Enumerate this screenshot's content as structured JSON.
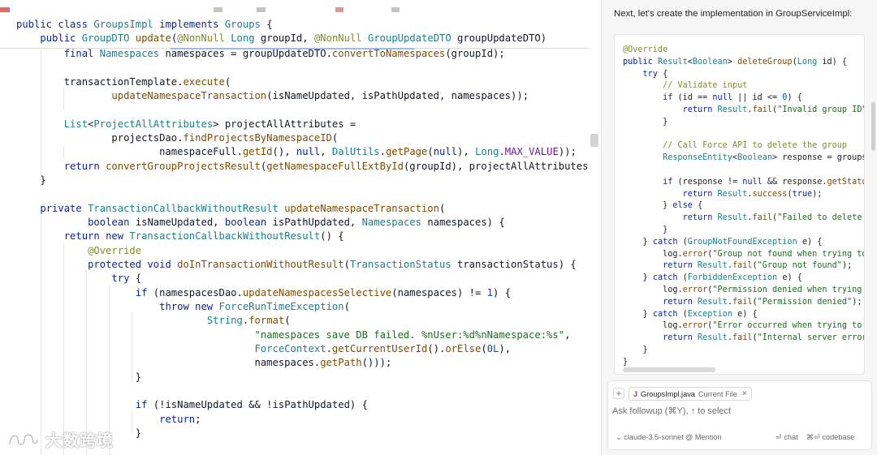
{
  "editor": {
    "sticky": [
      [
        [
          "kw",
          "public class "
        ],
        [
          "ty",
          "GroupsImpl "
        ],
        [
          "kw",
          "implements "
        ],
        [
          "ty",
          "Groups "
        ],
        [
          "",
          "{"
        ]
      ],
      [
        [
          "",
          "    "
        ],
        [
          "kw",
          "public "
        ],
        [
          "ty",
          "GroupDTO "
        ],
        [
          "fn",
          "update"
        ],
        [
          "",
          "("
        ],
        [
          "an",
          "@NonNull "
        ],
        [
          "ty",
          "Long "
        ],
        [
          "",
          "groupId, "
        ],
        [
          "an",
          "@NonNull "
        ],
        [
          "ty",
          "GroupUpdateDTO "
        ],
        [
          "",
          "groupUpdateDTO)"
        ]
      ]
    ],
    "lines": [
      [
        [
          "",
          "        "
        ],
        [
          "kw",
          "final "
        ],
        [
          "ty",
          "Namespaces "
        ],
        [
          "",
          "namespaces = groupUpdateDTO."
        ],
        [
          "fn",
          "convertToNamespaces"
        ],
        [
          "",
          "(groupId);"
        ]
      ],
      [],
      [
        [
          "",
          "        transactionTemplate."
        ],
        [
          "fn",
          "execute"
        ],
        [
          "",
          "("
        ]
      ],
      [
        [
          "",
          "                "
        ],
        [
          "fn",
          "updateNamespaceTransaction"
        ],
        [
          "",
          "(isNameUpdated, isPathUpdated, namespaces));"
        ]
      ],
      [],
      [
        [
          "",
          "        "
        ],
        [
          "ty",
          "List"
        ],
        [
          "",
          "<"
        ],
        [
          "ty",
          "ProjectAllAttributes"
        ],
        [
          "",
          "> projectAllAttributes ="
        ]
      ],
      [
        [
          "",
          "                projectsDao."
        ],
        [
          "fn",
          "findProjectsByNamespaceID"
        ],
        [
          "",
          "("
        ]
      ],
      [
        [
          "",
          "                        namespaceFull."
        ],
        [
          "fn",
          "getId"
        ],
        [
          "",
          "(), "
        ],
        [
          "kw",
          "null"
        ],
        [
          "",
          ", "
        ],
        [
          "ty",
          "DalUtils"
        ],
        [
          "",
          "."
        ],
        [
          "fn",
          "getPage"
        ],
        [
          "",
          "("
        ],
        [
          "kw",
          "null"
        ],
        [
          "",
          "), "
        ],
        [
          "ty",
          "Long"
        ],
        [
          "",
          "."
        ],
        [
          "cst",
          "MAX_VALUE"
        ],
        [
          "",
          "));"
        ]
      ],
      [
        [
          "",
          "        "
        ],
        [
          "kw",
          "return "
        ],
        [
          "fn",
          "convertGroupProjectsResult"
        ],
        [
          "",
          "("
        ],
        [
          "fn",
          "getNamespaceFullExtById"
        ],
        [
          "",
          "(groupId), projectAllAttributes);"
        ]
      ],
      [
        [
          "",
          "    }"
        ]
      ],
      [],
      [
        [
          "",
          "    "
        ],
        [
          "kw",
          "private "
        ],
        [
          "ty",
          "TransactionCallbackWithoutResult "
        ],
        [
          "fn",
          "updateNamespaceTransaction"
        ],
        [
          "",
          "("
        ]
      ],
      [
        [
          "",
          "            "
        ],
        [
          "kw",
          "boolean "
        ],
        [
          "",
          "isNameUpdated, "
        ],
        [
          "kw",
          "boolean "
        ],
        [
          "",
          "isPathUpdated, "
        ],
        [
          "ty",
          "Namespaces "
        ],
        [
          "",
          "namespaces) {"
        ]
      ],
      [
        [
          "",
          "        "
        ],
        [
          "kw",
          "return new "
        ],
        [
          "ty",
          "TransactionCallbackWithoutResult"
        ],
        [
          "",
          "() {"
        ]
      ],
      [
        [
          "",
          "            "
        ],
        [
          "an",
          "@Override"
        ]
      ],
      [
        [
          "",
          "            "
        ],
        [
          "kw",
          "protected void "
        ],
        [
          "fn",
          "doInTransactionWithoutResult"
        ],
        [
          "",
          "("
        ],
        [
          "ty",
          "TransactionStatus "
        ],
        [
          "",
          "transactionStatus) {"
        ]
      ],
      [
        [
          "",
          "                "
        ],
        [
          "kw",
          "try "
        ],
        [
          "",
          "{"
        ]
      ],
      [
        [
          "",
          "                    "
        ],
        [
          "kw",
          "if "
        ],
        [
          "",
          "(namespacesDao."
        ],
        [
          "fn",
          "updateNamespacesSelective"
        ],
        [
          "",
          "(namespaces) != "
        ],
        [
          "nm",
          "1"
        ],
        [
          "",
          ") {"
        ]
      ],
      [
        [
          "",
          "                        "
        ],
        [
          "kw",
          "throw new "
        ],
        [
          "ty",
          "ForceRunTimeException"
        ],
        [
          "",
          "("
        ]
      ],
      [
        [
          "",
          "                                "
        ],
        [
          "ty",
          "String"
        ],
        [
          "",
          "."
        ],
        [
          "fn",
          "format"
        ],
        [
          "",
          "("
        ]
      ],
      [
        [
          "",
          "                                        "
        ],
        [
          "st",
          "\"namespaces save DB failed. %nUser:%d%nNamespace:%s\""
        ],
        [
          "",
          ","
        ]
      ],
      [
        [
          "",
          "                                        "
        ],
        [
          "ty",
          "ForceContext"
        ],
        [
          "",
          "."
        ],
        [
          "fn",
          "getCurrentUserId"
        ],
        [
          "",
          "()."
        ],
        [
          "fn",
          "orElse"
        ],
        [
          "",
          "("
        ],
        [
          "nm",
          "0L"
        ],
        [
          "",
          "),"
        ]
      ],
      [
        [
          "",
          "                                        namespaces."
        ],
        [
          "fn",
          "getPath"
        ],
        [
          "",
          "()));"
        ]
      ],
      [
        [
          "",
          "                    }"
        ]
      ],
      [],
      [
        [
          "",
          "                    "
        ],
        [
          "kw",
          "if "
        ],
        [
          "",
          "(!isNameUpdated && !isPathUpdated) {"
        ]
      ],
      [
        [
          "",
          "                        "
        ],
        [
          "kw",
          "return"
        ],
        [
          "",
          ";"
        ]
      ],
      [
        [
          "",
          "                    }"
        ]
      ]
    ]
  },
  "watermark": {
    "text": "大数跨境"
  },
  "chat": {
    "intro": "Next, let's create the implementation in GroupServiceImpl:",
    "code": [
      [
        [
          "an",
          "@Override"
        ]
      ],
      [
        [
          "kw",
          "public "
        ],
        [
          "ty",
          "Result"
        ],
        [
          "",
          "<"
        ],
        [
          "ty",
          "Boolean"
        ],
        [
          "",
          "> "
        ],
        [
          "fn",
          "deleteGroup"
        ],
        [
          "",
          "("
        ],
        [
          "ty",
          "Long "
        ],
        [
          "",
          "id) {"
        ]
      ],
      [
        [
          "",
          "    "
        ],
        [
          "kw",
          "try "
        ],
        [
          "",
          "{"
        ]
      ],
      [
        [
          "",
          "        "
        ],
        [
          "an",
          "// Validate input"
        ]
      ],
      [
        [
          "",
          "        "
        ],
        [
          "kw",
          "if "
        ],
        [
          "",
          "(id == "
        ],
        [
          "kw",
          "null "
        ],
        [
          "",
          "|| id <= "
        ],
        [
          "nm",
          "0"
        ],
        [
          "",
          ") {"
        ]
      ],
      [
        [
          "",
          "            "
        ],
        [
          "kw",
          "return "
        ],
        [
          "ty",
          "Result"
        ],
        [
          "",
          "."
        ],
        [
          "fn",
          "fail"
        ],
        [
          "",
          "("
        ],
        [
          "st",
          "\"Invalid group ID\""
        ],
        [
          "",
          ");"
        ]
      ],
      [
        [
          "",
          "        }"
        ]
      ],
      [],
      [
        [
          "",
          "        "
        ],
        [
          "an",
          "// Call Force API to delete the group"
        ]
      ],
      [
        [
          "",
          "        "
        ],
        [
          "ty",
          "ResponseEntity"
        ],
        [
          "",
          "<"
        ],
        [
          "ty",
          "Boolean"
        ],
        [
          "",
          "> response = groupsApi."
        ],
        [
          "fn",
          "deleteGroup"
        ],
        [
          "",
          "(id);"
        ]
      ],
      [],
      [
        [
          "",
          "        "
        ],
        [
          "kw",
          "if "
        ],
        [
          "",
          "(response != "
        ],
        [
          "kw",
          "null "
        ],
        [
          "",
          "&& response."
        ],
        [
          "fn",
          "getStatusCode"
        ],
        [
          "",
          "()."
        ],
        [
          "fn",
          "is2xxSuccessful"
        ],
        [
          "",
          "()) {"
        ]
      ],
      [
        [
          "",
          "            "
        ],
        [
          "kw",
          "return "
        ],
        [
          "ty",
          "Result"
        ],
        [
          "",
          "."
        ],
        [
          "fn",
          "success"
        ],
        [
          "",
          "("
        ],
        [
          "kw",
          "true"
        ],
        [
          "",
          ");"
        ]
      ],
      [
        [
          "",
          "        } "
        ],
        [
          "kw",
          "else "
        ],
        [
          "",
          "{"
        ]
      ],
      [
        [
          "",
          "            "
        ],
        [
          "kw",
          "return "
        ],
        [
          "ty",
          "Result"
        ],
        [
          "",
          "."
        ],
        [
          "fn",
          "fail"
        ],
        [
          "",
          "("
        ],
        [
          "st",
          "\"Failed to delete group\""
        ],
        [
          "",
          ");"
        ]
      ],
      [
        [
          "",
          "        }"
        ]
      ],
      [
        [
          "",
          "    } "
        ],
        [
          "kw",
          "catch "
        ],
        [
          "",
          "("
        ],
        [
          "ty",
          "GroupNotFoundException "
        ],
        [
          "",
          "e) {"
        ]
      ],
      [
        [
          "",
          "        log."
        ],
        [
          "fn",
          "error"
        ],
        [
          "",
          "("
        ],
        [
          "st",
          "\"Group not found when trying to delete\""
        ],
        [
          "",
          ", e);"
        ]
      ],
      [
        [
          "",
          "        "
        ],
        [
          "kw",
          "return "
        ],
        [
          "ty",
          "Result"
        ],
        [
          "",
          "."
        ],
        [
          "fn",
          "fail"
        ],
        [
          "",
          "("
        ],
        [
          "st",
          "\"Group not found\""
        ],
        [
          "",
          ");"
        ]
      ],
      [
        [
          "",
          "    } "
        ],
        [
          "kw",
          "catch "
        ],
        [
          "",
          "("
        ],
        [
          "ty",
          "ForbiddenException "
        ],
        [
          "",
          "e) {"
        ]
      ],
      [
        [
          "",
          "        log."
        ],
        [
          "fn",
          "error"
        ],
        [
          "",
          "("
        ],
        [
          "st",
          "\"Permission denied when trying to delete group\""
        ],
        [
          "",
          ", e);"
        ]
      ],
      [
        [
          "",
          "        "
        ],
        [
          "kw",
          "return "
        ],
        [
          "ty",
          "Result"
        ],
        [
          "",
          "."
        ],
        [
          "fn",
          "fail"
        ],
        [
          "",
          "("
        ],
        [
          "st",
          "\"Permission denied\""
        ],
        [
          "",
          ");"
        ]
      ],
      [
        [
          "",
          "    } "
        ],
        [
          "kw",
          "catch "
        ],
        [
          "",
          "("
        ],
        [
          "ty",
          "Exception "
        ],
        [
          "",
          "e) {"
        ]
      ],
      [
        [
          "",
          "        log."
        ],
        [
          "fn",
          "error"
        ],
        [
          "",
          "("
        ],
        [
          "st",
          "\"Error occurred when trying to delete group\""
        ],
        [
          "",
          ", e);"
        ]
      ],
      [
        [
          "",
          "        "
        ],
        [
          "kw",
          "return "
        ],
        [
          "ty",
          "Result"
        ],
        [
          "",
          "."
        ],
        [
          "fn",
          "fail"
        ],
        [
          "",
          "("
        ],
        [
          "st",
          "\"Internal server error\""
        ],
        [
          "",
          ");"
        ]
      ],
      [
        [
          "",
          "    }"
        ]
      ],
      [
        [
          "",
          "}"
        ]
      ]
    ],
    "composer": {
      "add_label": "+",
      "file_chip": {
        "icon": "J",
        "name": "GroupsImpl.java",
        "sub": "Current File",
        "close": "×"
      },
      "placeholder": "Ask followup (⌘Y), ↑ to select",
      "model": "claude-3.5-sonnet",
      "mention": "@ Mention",
      "chat_btn": "⏎ chat",
      "codebase_btn": "⌘⏎ codebase"
    }
  },
  "colors": {
    "keyword": "#0b1fa3",
    "type": "#1a7f8e",
    "method": "#7d4b00",
    "annotation": "#7a8f2c",
    "string": "#1f6b24",
    "number": "#0d47c4",
    "constant": "#6a1b9a",
    "panel_bg": "#f6f6f6"
  }
}
